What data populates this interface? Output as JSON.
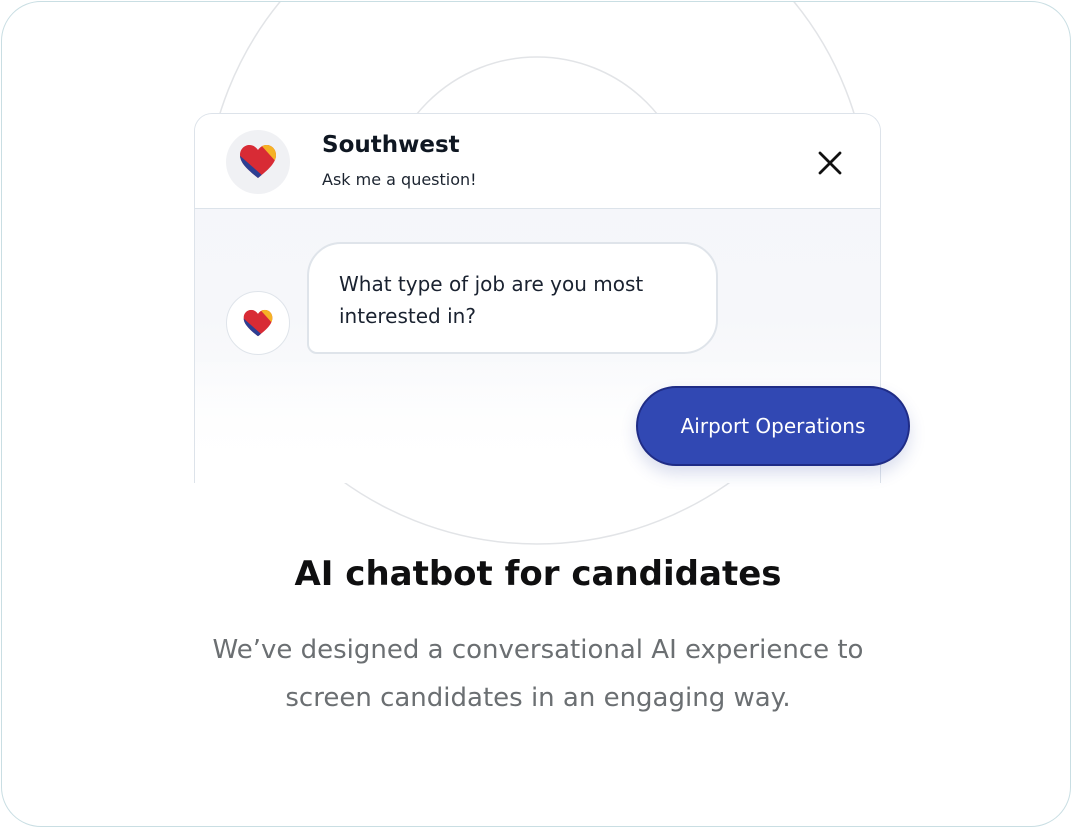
{
  "chat": {
    "brand_name": "Southwest",
    "brand_subtitle": "Ask me a question!",
    "close_icon": "close-icon",
    "logo_icon": "southwest-heart-logo",
    "bot_message": "What type of job are you most interested in?",
    "reply_option": "Airport Operations"
  },
  "feature": {
    "title": "AI chatbot for candidates",
    "description_line1": "We’ve designed a conversational AI experience to",
    "description_line2": "screen candidates in an engaging way."
  },
  "colors": {
    "card_border": "#c9dee3",
    "reply_button": "#3148b3",
    "reply_button_border": "#1f2c86",
    "logo_blue": "#2c3f93",
    "logo_red": "#d82b35",
    "logo_yellow": "#f5b225",
    "headline_text": "#0f0f10",
    "description_text": "#6b6f72"
  }
}
